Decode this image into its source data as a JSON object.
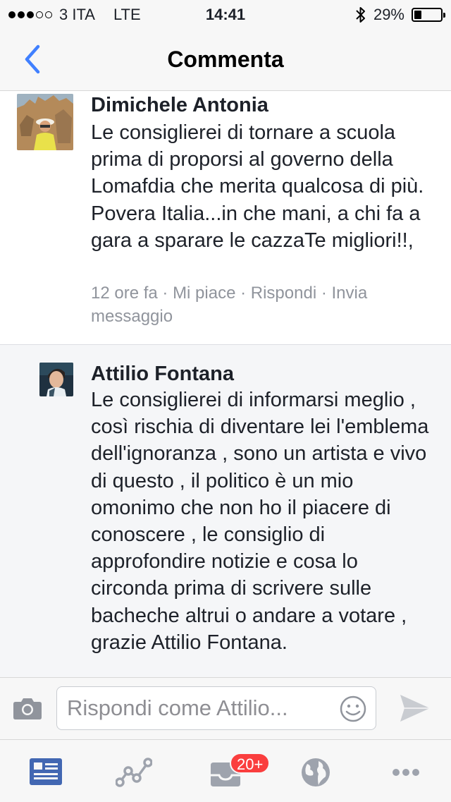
{
  "status_bar": {
    "carrier": "3 ITA",
    "network": "LTE",
    "time": "14:41",
    "battery_percent_text": "29%",
    "battery_level": 0.29,
    "signal_bars": 3,
    "signal_total": 5
  },
  "nav": {
    "title": "Commenta",
    "back_icon": "chevron-left-icon"
  },
  "comments": [
    {
      "author": "Dimichele Antonia",
      "text": "Le consiglierei di tornare a scuola prima di proporsi al governo della Lomafdia che merita qualcosa di più. Povera Italia...in che mani,  a chi fa a gara a sparare le cazzaTe migliori!!,",
      "time": "12 ore fa",
      "like": "Mi piace",
      "reply": "Rispondi",
      "message": "Invia messaggio"
    },
    {
      "author": "Attilio Fontana",
      "text": "Le consiglierei di informarsi meglio , così rischia di diventare lei l'emblema dell'ignoranza , sono un artista e vivo di questo , il politico è un mio omonimo che non ho il piacere di conoscere , le consiglio di approfondire notizie e cosa lo circonda prima di scrivere sulle bacheche altrui o andare a votare , grazie Attilio Fontana."
    }
  ],
  "composer": {
    "placeholder": "Rispondi come Attilio..."
  },
  "tabbar": {
    "notifications_badge": "20+"
  },
  "colors": {
    "accent": "#4080ff",
    "badge": "#fa3e3e",
    "active_tab": "#4267b2",
    "inactive_icon": "#9ea3ad"
  }
}
